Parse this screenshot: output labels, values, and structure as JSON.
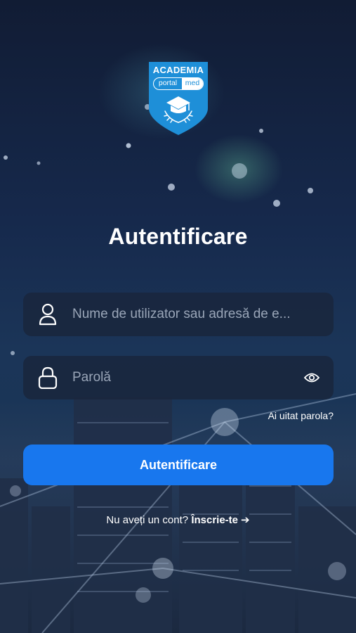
{
  "logo": {
    "title": "ACADEMIA",
    "word_left": "portal",
    "word_right": "med"
  },
  "page_title": "Autentificare",
  "form": {
    "username_placeholder": "Nume de utilizator sau adresă de e...",
    "password_placeholder": "Parolă",
    "forgot_password": "Ai uitat parola?",
    "submit_label": "Autentificare"
  },
  "signup": {
    "prompt": "Nu aveți un cont?",
    "link": "Înscrie-te",
    "arrow": "➔"
  },
  "colors": {
    "accent": "#1877ee",
    "logo_blue": "#1e8fd8"
  }
}
